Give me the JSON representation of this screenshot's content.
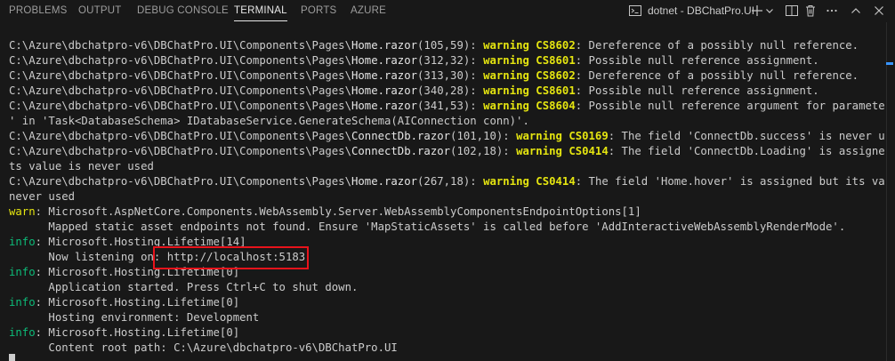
{
  "tabs": [
    {
      "label": "PROBLEMS",
      "active": false
    },
    {
      "label": "OUTPUT",
      "active": false
    },
    {
      "label": "DEBUG CONSOLE",
      "active": false
    },
    {
      "label": "TERMINAL",
      "active": true
    },
    {
      "label": "PORTS",
      "active": false
    },
    {
      "label": "AZURE",
      "active": false
    }
  ],
  "terminal_instance": {
    "label": "dotnet - DBChatPro.UI",
    "icon": "terminal-icon"
  },
  "toolbar_icons": [
    "plus-icon",
    "chevron-down-icon",
    "split-icon",
    "trash-icon",
    "ellipsis-icon",
    "maximize-icon",
    "close-icon"
  ],
  "colors": {
    "background": "#181818",
    "warning": "#e5e510",
    "info": "#0dbc79",
    "highlight_box": "#e8131b"
  },
  "lines": [
    {
      "segments": [
        {
          "t": "C:\\Azure\\dbchatpro-v6\\DBChatPro.UI\\Components\\Pages\\"
        },
        {
          "t": "Home.razor",
          "c": "w"
        },
        {
          "t": "(105,59): "
        },
        {
          "t": "warning CS8602",
          "c": "b"
        },
        {
          "t": ": Dereference of a possibly null reference."
        }
      ]
    },
    {
      "segments": [
        {
          "t": "C:\\Azure\\dbchatpro-v6\\DBChatPro.UI\\Components\\Pages\\"
        },
        {
          "t": "Home.razor",
          "c": "w"
        },
        {
          "t": "(312,32): "
        },
        {
          "t": "warning CS8601",
          "c": "b"
        },
        {
          "t": ": Possible null reference assignment."
        }
      ]
    },
    {
      "segments": [
        {
          "t": "C:\\Azure\\dbchatpro-v6\\DBChatPro.UI\\Components\\Pages\\"
        },
        {
          "t": "Home.razor",
          "c": "w"
        },
        {
          "t": "(313,30): "
        },
        {
          "t": "warning CS8602",
          "c": "b"
        },
        {
          "t": ": Dereference of a possibly null reference."
        }
      ]
    },
    {
      "segments": [
        {
          "t": "C:\\Azure\\dbchatpro-v6\\DBChatPro.UI\\Components\\Pages\\"
        },
        {
          "t": "Home.razor",
          "c": "w"
        },
        {
          "t": "(340,28): "
        },
        {
          "t": "warning CS8601",
          "c": "b"
        },
        {
          "t": ": Possible null reference assignment."
        }
      ]
    },
    {
      "segments": [
        {
          "t": "C:\\Azure\\dbchatpro-v6\\DBChatPro.UI\\Components\\Pages\\"
        },
        {
          "t": "Home.razor",
          "c": "w"
        },
        {
          "t": "(341,53): "
        },
        {
          "t": "warning CS8604",
          "c": "b"
        },
        {
          "t": ": Possible null reference argument for parameter 'conn"
        }
      ]
    },
    {
      "segments": [
        {
          "t": "' in 'Task<DatabaseSchema> IDatabaseService.GenerateSchema(AIConnection conn)'."
        }
      ]
    },
    {
      "segments": [
        {
          "t": "C:\\Azure\\dbchatpro-v6\\DBChatPro.UI\\Components\\Pages\\"
        },
        {
          "t": "ConnectDb.razor",
          "c": "w"
        },
        {
          "t": "(101,10): "
        },
        {
          "t": "warning CS0169",
          "c": "b"
        },
        {
          "t": ": The field 'ConnectDb.success' is never used"
        }
      ]
    },
    {
      "segments": [
        {
          "t": "C:\\Azure\\dbchatpro-v6\\DBChatPro.UI\\Components\\Pages\\"
        },
        {
          "t": "ConnectDb.razor",
          "c": "w"
        },
        {
          "t": "(102,18): "
        },
        {
          "t": "warning CS0414",
          "c": "b"
        },
        {
          "t": ": The field 'ConnectDb.Loading' is assigned but i"
        }
      ]
    },
    {
      "segments": [
        {
          "t": "ts value is never used"
        }
      ]
    },
    {
      "segments": [
        {
          "t": "C:\\Azure\\dbchatpro-v6\\DBChatPro.UI\\Components\\Pages\\"
        },
        {
          "t": "Home.razor",
          "c": "w"
        },
        {
          "t": "(267,18): "
        },
        {
          "t": "warning CS0414",
          "c": "b"
        },
        {
          "t": ": The field 'Home.hover' is assigned but its value is"
        }
      ]
    },
    {
      "segments": [
        {
          "t": "never used"
        }
      ]
    },
    {
      "segments": [
        {
          "t": "warn",
          "c": "y"
        },
        {
          "t": ": Microsoft.AspNetCore.Components.WebAssembly.Server.WebAssemblyComponentsEndpointOptions[1]"
        }
      ]
    },
    {
      "segments": [
        {
          "t": "      Mapped static asset endpoints not found. Ensure 'MapStaticAssets' is called before 'AddInteractiveWebAssemblyRenderMode'."
        }
      ]
    },
    {
      "segments": [
        {
          "t": "info",
          "c": "g"
        },
        {
          "t": ": Microsoft.Hosting.Lifetime[14]"
        }
      ]
    },
    {
      "segments": [
        {
          "t": "      Now listening on: "
        },
        {
          "t": "http://localhost:5183"
        }
      ]
    },
    {
      "segments": [
        {
          "t": "info",
          "c": "g"
        },
        {
          "t": ": Microsoft.Hosting.Lifetime[0]"
        }
      ]
    },
    {
      "segments": [
        {
          "t": "      Application started. Press Ctrl+C to shut down."
        }
      ]
    },
    {
      "segments": [
        {
          "t": "info",
          "c": "g"
        },
        {
          "t": ": Microsoft.Hosting.Lifetime[0]"
        }
      ]
    },
    {
      "segments": [
        {
          "t": "      Hosting environment: Development"
        }
      ]
    },
    {
      "segments": [
        {
          "t": "info",
          "c": "g"
        },
        {
          "t": ": Microsoft.Hosting.Lifetime[0]"
        }
      ]
    },
    {
      "segments": [
        {
          "t": "      Content root path: C:\\Azure\\dbchatpro-v6\\DBChatPro.UI"
        }
      ]
    }
  ]
}
